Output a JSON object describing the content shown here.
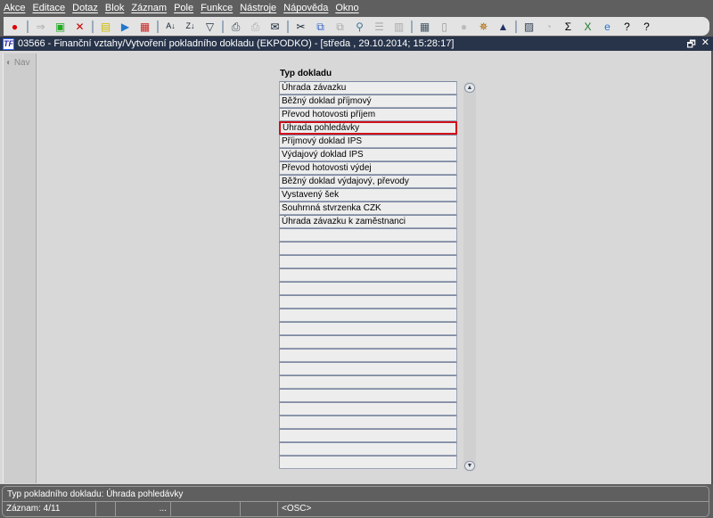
{
  "menu": [
    "Akce",
    "Editace",
    "Dotaz",
    "Blok",
    "Záznam",
    "Pole",
    "Funkce",
    "Nástroje",
    "Nápověda",
    "Okno"
  ],
  "toolbar": [
    {
      "name": "exit-icon",
      "glyph": "●",
      "color": "#d00"
    },
    {
      "name": "sep"
    },
    {
      "name": "save-disabled-icon",
      "glyph": "⇒",
      "color": "#aaa"
    },
    {
      "name": "save-record-icon",
      "glyph": "▣",
      "color": "#2a2"
    },
    {
      "name": "delete-record-icon",
      "glyph": "✕",
      "color": "#c00"
    },
    {
      "name": "sep"
    },
    {
      "name": "insert-record-icon",
      "glyph": "▤",
      "color": "#cb0"
    },
    {
      "name": "next-record-icon",
      "glyph": "▶",
      "color": "#27c"
    },
    {
      "name": "clear-record-icon",
      "glyph": "▦",
      "color": "#c22"
    },
    {
      "name": "sep"
    },
    {
      "name": "sort-asc-icon",
      "glyph": "A↓",
      "color": "#123"
    },
    {
      "name": "sort-desc-icon",
      "glyph": "Z↓",
      "color": "#123"
    },
    {
      "name": "filter-icon",
      "glyph": "▽",
      "color": "#234"
    },
    {
      "name": "sep"
    },
    {
      "name": "print-icon",
      "glyph": "⎙",
      "color": "#345"
    },
    {
      "name": "print-setup-icon",
      "glyph": "⎙",
      "color": "#aaa"
    },
    {
      "name": "mail-icon",
      "glyph": "✉",
      "color": "#123"
    },
    {
      "name": "sep"
    },
    {
      "name": "cut-icon",
      "glyph": "✂",
      "color": "#123"
    },
    {
      "name": "copy-icon",
      "glyph": "⧉",
      "color": "#36c"
    },
    {
      "name": "paste-icon",
      "glyph": "⧉",
      "color": "#aaa"
    },
    {
      "name": "zoom-icon",
      "glyph": "⚲",
      "color": "#479"
    },
    {
      "name": "indent-icon",
      "glyph": "☰",
      "color": "#aaa"
    },
    {
      "name": "columns-icon",
      "glyph": "▥",
      "color": "#aaa"
    },
    {
      "name": "sep"
    },
    {
      "name": "import-icon",
      "glyph": "▦",
      "color": "#456"
    },
    {
      "name": "document-icon",
      "glyph": "▯",
      "color": "#999"
    },
    {
      "name": "globe-icon",
      "glyph": "●",
      "color": "#bbb"
    },
    {
      "name": "wheel-icon",
      "glyph": "✵",
      "color": "#a60"
    },
    {
      "name": "eye-icon",
      "glyph": "▲",
      "color": "#236"
    },
    {
      "name": "sep"
    },
    {
      "name": "chart-icon",
      "glyph": "▨",
      "color": "#345"
    },
    {
      "name": "clock-icon",
      "glyph": "◔",
      "color": "#bbb"
    },
    {
      "name": "sum-icon",
      "glyph": "Σ",
      "color": "#000"
    },
    {
      "name": "excel-icon",
      "glyph": "X",
      "color": "#1a7a2a"
    },
    {
      "name": "ie-icon",
      "glyph": "e",
      "color": "#27c"
    },
    {
      "name": "help-lock-icon",
      "glyph": "?",
      "color": "#000"
    },
    {
      "name": "help-icon",
      "glyph": "?",
      "color": "#000"
    }
  ],
  "window": {
    "title": "03566 - Finanční vztahy/Vytvoření pokladního dokladu (EKPODKO) - [středa , 29.10.2014; 15:28:17]",
    "logo": "TF",
    "restore": "🗗",
    "close": "✕"
  },
  "nav": {
    "label": "Nav"
  },
  "form": {
    "label": "Typ dokladu",
    "items": [
      "Úhrada závazku",
      "Běžný doklad příjmový",
      "Převod hotovosti příjem",
      "Úhrada pohledávky",
      "Příjmový doklad IPS",
      "Výdajový doklad IPS",
      "Převod hotovosti výdej",
      "Běžný doklad výdajový, převody",
      "Vystavený šek",
      "Souhrnná stvrzenka CZK",
      "Úhrada závazku k zaměstnanci"
    ],
    "selected_index": 3,
    "total_rows": 29
  },
  "status": {
    "message": "Typ pokladního dokladu: Úhrada pohledávky",
    "record": "Záznam: 4/11",
    "ellipsis": "...",
    "mode": "<OSC>"
  }
}
